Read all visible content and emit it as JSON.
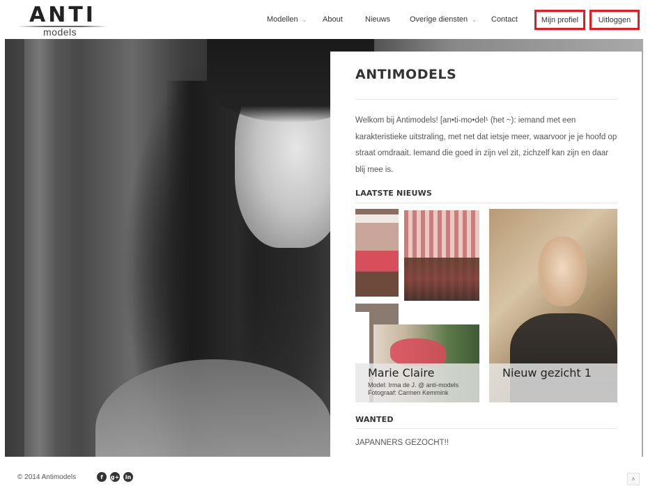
{
  "logo": {
    "word": "ANTI",
    "sub": "models"
  },
  "nav": {
    "items": [
      {
        "label": "Modellen",
        "caret": "⌄"
      },
      {
        "label": "About"
      },
      {
        "label": "Nieuws"
      },
      {
        "label": "Overige diensten",
        "caret": "⌄"
      },
      {
        "label": "Contact"
      }
    ],
    "profile_label": "Mijn profiel",
    "logout_label": "Uitloggen",
    "highlight_color": "#e31b23"
  },
  "panel": {
    "title": "ANTIMODELS",
    "intro": "Welkom bij Antimodels! [an•ti-mo•del¹ (het ~): iemand met een karakteristieke uitstraling, met net dat ietsje meer, waarvoor je je hoofd op straat omdraait. Iemand die goed in zijn vel zit, zichzelf kan zijn en daar blij mee is.",
    "news_heading": "LAATSTE NIEUWS",
    "news": [
      {
        "title": "Marie Claire",
        "meta_1": "Model: Irma de J. @ anti-models",
        "meta_2": "Fotograaf: Carmen Kemmink"
      },
      {
        "title": "Nieuw gezicht 1"
      }
    ],
    "wanted_heading": "WANTED",
    "wanted_item": "JAPANNERS GEZOCHT!!"
  },
  "footer": {
    "copyright": "© 2014 Antimodels",
    "social": [
      {
        "icon": "facebook-icon",
        "glyph": "f"
      },
      {
        "icon": "google-plus-icon",
        "glyph": "g+"
      },
      {
        "icon": "linkedin-icon",
        "glyph": "in"
      }
    ],
    "to_top_glyph": "˄"
  }
}
